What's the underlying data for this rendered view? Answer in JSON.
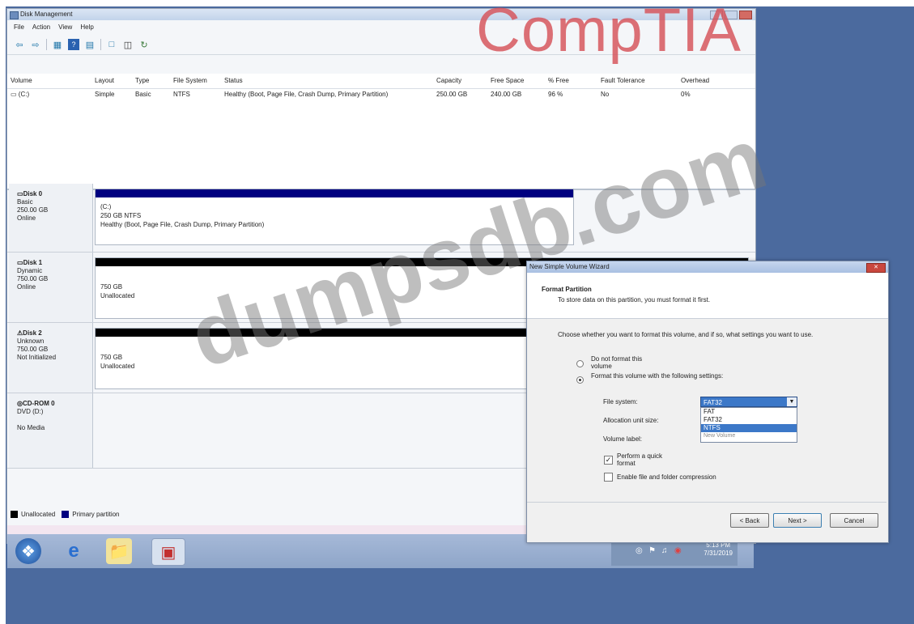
{
  "window": {
    "title": "Disk Management"
  },
  "menu": [
    "File",
    "Action",
    "View",
    "Help"
  ],
  "icons": {
    "back": "back-arrow-icon",
    "forward": "forward-arrow-icon",
    "properties": "properties-icon",
    "help": "help-icon"
  },
  "volumes": {
    "columns": [
      "Volume",
      "Layout",
      "Type",
      "File System",
      "Status",
      "Capacity",
      "Free Space",
      "% Free",
      "Fault Tolerance",
      "Overhead"
    ],
    "rows": [
      {
        "volume": "(C:)",
        "layout": "Simple",
        "type": "Basic",
        "fs": "NTFS",
        "status": "Healthy (Boot, Page File, Crash Dump, Primary Partition)",
        "capacity": "250.00 GB",
        "free": "240.00 GB",
        "pct": "96 %",
        "fault": "No",
        "overhead": "0%"
      }
    ]
  },
  "disks": [
    {
      "name": "Disk 0",
      "type": "Basic",
      "size": "250.00 GB",
      "status": "Online",
      "part_title": "(C:)",
      "part_line1": "250 GB NTFS",
      "part_line2": "Healthy (Boot, Page File, Crash Dump, Primary Partition)"
    },
    {
      "name": "Disk 1",
      "type": "Dynamic",
      "size": "750.00 GB",
      "status": "Online",
      "part_line1": "750 GB",
      "part_line2": "Unallocated"
    },
    {
      "name": "Disk 2",
      "type": "Unknown",
      "size": "750.00 GB",
      "status": "Not Initialized",
      "part_line1": "750 GB",
      "part_line2": "Unallocated"
    },
    {
      "name": "CD-ROM 0",
      "type": "DVD (D:)",
      "status": "No Media"
    }
  ],
  "legend": {
    "unallocated": "Unallocated",
    "primary": "Primary partition",
    "unallocated_color": "#000000",
    "primary_color": "#000080"
  },
  "wizard": {
    "title": "New Simple Volume Wizard",
    "heading": "Format Partition",
    "subheading": "To store data on this partition, you must format it first.",
    "prompt": "Choose whether you want to format this volume, and if so, what settings you want to use.",
    "opt_noformat": "Do not format this volume",
    "opt_format": "Format this volume with the following settings:",
    "fs_label": "File system:",
    "fs_value": "FAT32",
    "fs_options": [
      "FAT",
      "FAT32",
      "NTFS"
    ],
    "alloc_label": "Allocation unit size:",
    "vol_label": "Volume label:",
    "vol_value": "New Volume",
    "quick": "Perform a quick format",
    "compress": "Enable file and folder compression",
    "back": "< Back",
    "next": "Next >",
    "cancel": "Cancel"
  },
  "taskbar": {
    "time": "5:13 PM",
    "date": "7/31/2019"
  },
  "watermarks": {
    "top": "CompTIA",
    "center": "dumpsdb.com"
  }
}
